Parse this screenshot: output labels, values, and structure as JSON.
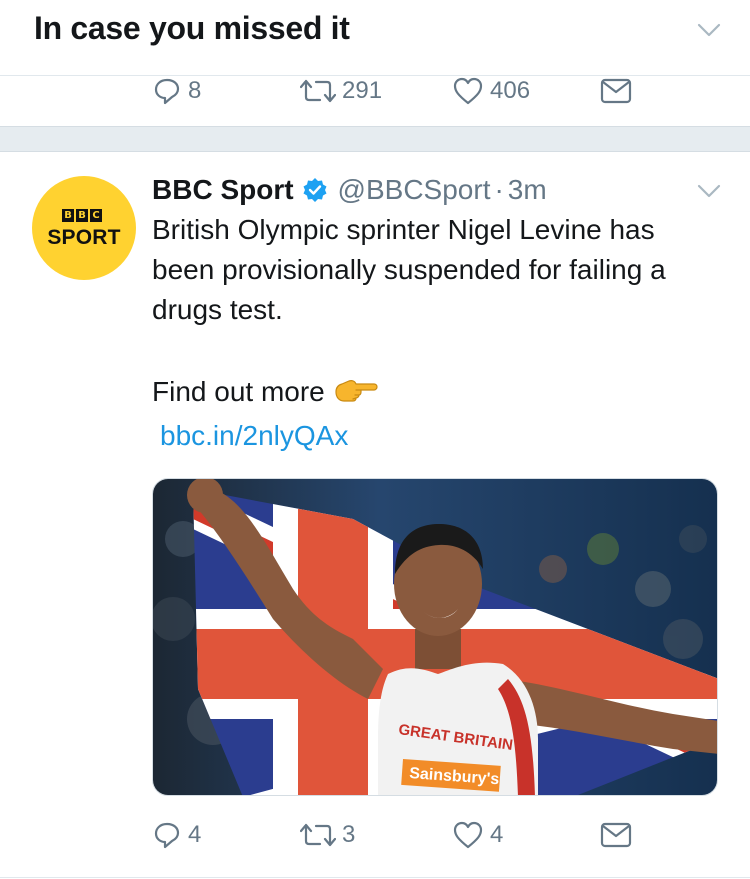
{
  "section": {
    "title": "In case you missed it"
  },
  "prev_tweet_actions": {
    "reply_count": "8",
    "retweet_count": "291",
    "like_count": "406"
  },
  "tweet": {
    "author_name": "BBC Sport",
    "handle": "@BBCSport",
    "separator": "·",
    "time": "3m",
    "body": "British Olympic sprinter Nigel Levine has been provisionally suspended for failing a drugs test.",
    "find_more": "Find out more",
    "link": "bbc.in/2nlyQAx",
    "avatar": {
      "letters": [
        "B",
        "B",
        "C"
      ],
      "word": "SPORT"
    },
    "media": {
      "vest_text": "GREAT BRITAIN",
      "sponsor": "Sainsbury's"
    },
    "actions": {
      "reply_count": "4",
      "retweet_count": "3",
      "like_count": "4"
    }
  },
  "colors": {
    "brand_blue": "#1b95e0",
    "muted": "#657786",
    "avatar_yellow": "#ffd230",
    "divider": "#e6ecf0"
  },
  "icons": [
    "chevron-down-icon",
    "reply-icon",
    "retweet-icon",
    "like-icon",
    "message-icon",
    "verified-badge-icon",
    "pointing-finger-icon"
  ]
}
